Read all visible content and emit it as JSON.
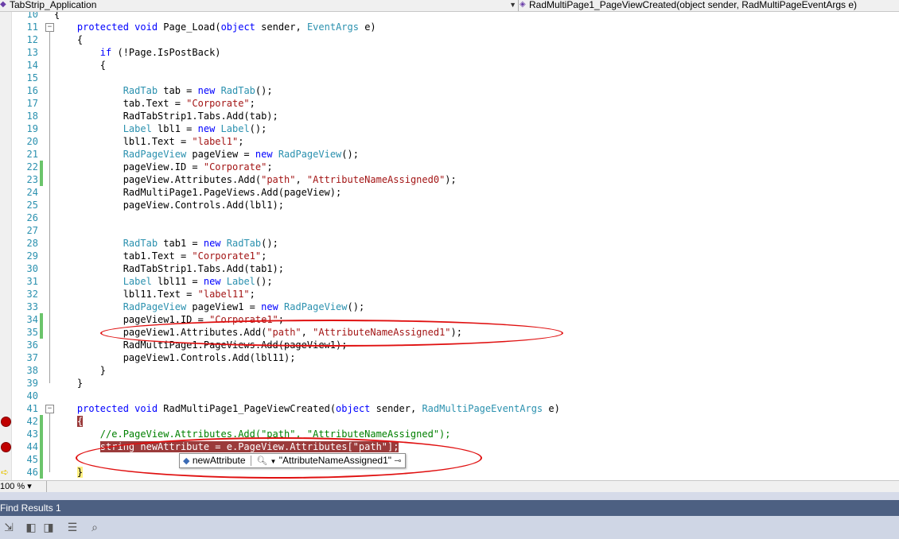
{
  "nav": {
    "class_dropdown": "TabStrip_Application",
    "member_dropdown": "RadMultiPage1_PageViewCreated(object sender, RadMultiPageEventArgs e)"
  },
  "code_lines": [
    {
      "n": "10",
      "t": "{"
    },
    {
      "n": "11",
      "t": "    protected void Page_Load(object sender, EventArgs e)"
    },
    {
      "n": "12",
      "t": "    {"
    },
    {
      "n": "13",
      "t": "        if (!Page.IsPostBack)"
    },
    {
      "n": "14",
      "t": "        {"
    },
    {
      "n": "15",
      "t": ""
    },
    {
      "n": "16",
      "t": "            RadTab tab = new RadTab();"
    },
    {
      "n": "17",
      "t": "            tab.Text = \"Corporate\";"
    },
    {
      "n": "18",
      "t": "            RadTabStrip1.Tabs.Add(tab);"
    },
    {
      "n": "19",
      "t": "            Label lbl1 = new Label();"
    },
    {
      "n": "20",
      "t": "            lbl1.Text = \"label1\";"
    },
    {
      "n": "21",
      "t": "            RadPageView pageView = new RadPageView();"
    },
    {
      "n": "22",
      "t": "            pageView.ID = \"Corporate\";"
    },
    {
      "n": "23",
      "t": "            pageView.Attributes.Add(\"path\", \"AttributeNameAssigned0\");"
    },
    {
      "n": "24",
      "t": "            RadMultiPage1.PageViews.Add(pageView);"
    },
    {
      "n": "25",
      "t": "            pageView.Controls.Add(lbl1);"
    },
    {
      "n": "26",
      "t": ""
    },
    {
      "n": "27",
      "t": ""
    },
    {
      "n": "28",
      "t": "            RadTab tab1 = new RadTab();"
    },
    {
      "n": "29",
      "t": "            tab1.Text = \"Corporate1\";"
    },
    {
      "n": "30",
      "t": "            RadTabStrip1.Tabs.Add(tab1);"
    },
    {
      "n": "31",
      "t": "            Label lbl11 = new Label();"
    },
    {
      "n": "32",
      "t": "            lbl11.Text = \"label11\";"
    },
    {
      "n": "33",
      "t": "            RadPageView pageView1 = new RadPageView();"
    },
    {
      "n": "34",
      "t": "            pageView1.ID = \"Corporate1\";"
    },
    {
      "n": "35",
      "t": "            pageView1.Attributes.Add(\"path\", \"AttributeNameAssigned1\");"
    },
    {
      "n": "36",
      "t": "            RadMultiPage1.PageViews.Add(pageView1);"
    },
    {
      "n": "37",
      "t": "            pageView1.Controls.Add(lbl11);"
    },
    {
      "n": "38",
      "t": "        }"
    },
    {
      "n": "39",
      "t": "    }"
    },
    {
      "n": "40",
      "t": ""
    },
    {
      "n": "41",
      "t": "    protected void RadMultiPage1_PageViewCreated(object sender, RadMultiPageEventArgs e)"
    },
    {
      "n": "42",
      "t": "    {"
    },
    {
      "n": "43",
      "t": "        //e.PageView.Attributes.Add(\"path\", \"AttributeNameAssigned\");"
    },
    {
      "n": "44",
      "t": "        string newAttribute = e.PageView.Attributes[\"path\"];"
    },
    {
      "n": "45",
      "t": ""
    },
    {
      "n": "46",
      "t": "    }"
    }
  ],
  "tooltip": {
    "name": "newAttribute",
    "value": "\"AttributeNameAssigned1\""
  },
  "zoom": "100 %",
  "find_panel": {
    "title": "Find Results 1"
  },
  "colors": {
    "keyword": "#0000ff",
    "type": "#2b91af",
    "string": "#a31515",
    "comment": "#008000",
    "breakpoint": "#c00000",
    "annotation": "#e01010"
  },
  "icons": [
    "class-icon",
    "method-icon",
    "dropdown-arrow-icon",
    "breakpoint-icon",
    "current-line-arrow-icon",
    "magnifier-icon",
    "pin-icon",
    "go-to-icon",
    "prev-result-icon",
    "next-result-icon",
    "clear-icon",
    "stop-find-icon"
  ]
}
